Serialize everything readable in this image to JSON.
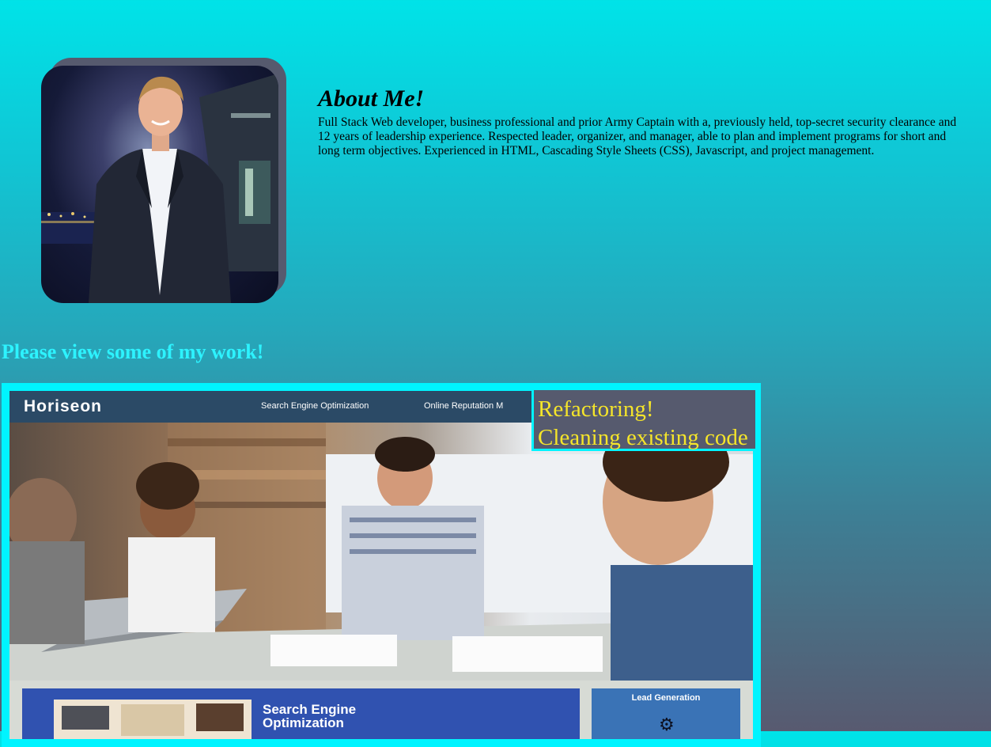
{
  "about": {
    "heading": "About Me!",
    "body": "Full Stack Web developer, business professional and prior Army Captain with a, previously held, top-secret security clearance and 12 years of leadership experience. Respected leader, organizer, and manager, able to plan and implement programs for short and long term objectives. Experienced in HTML, Cascading Style Sheets (CSS), Javascript, and project management."
  },
  "work": {
    "heading": "Please view some of my work!"
  },
  "project": {
    "screenshot": {
      "logo": "Horiseon",
      "nav": [
        "Search Engine Optimization",
        "Online Reputation M"
      ],
      "seo_title_line1": "Search Engine",
      "seo_title_line2": "Optimization",
      "lead_title": "Lead Generation"
    },
    "caption": {
      "title": "Refactoring!",
      "subtitle": "Cleaning existing code"
    }
  },
  "colors": {
    "accent": "#00f4ff",
    "caption_text": "#f5e52a",
    "caption_bg": "#565a6e",
    "heading_cyan": "#2df3ff"
  }
}
